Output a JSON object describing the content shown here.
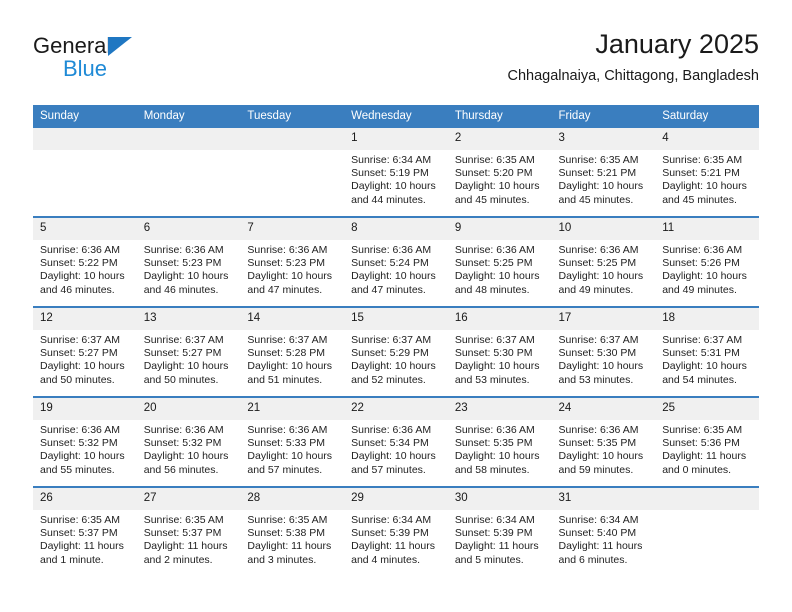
{
  "brand": {
    "line1": "General",
    "line2": "Blue",
    "triangle_color": "#1f77c2",
    "blue_color": "#1f8ad6"
  },
  "header": {
    "title": "January 2025",
    "subtitle": "Chhagalnaiya, Chittagong, Bangladesh",
    "accent_color": "#3a7ebf"
  },
  "calendar": {
    "weekday_headers": [
      "Sunday",
      "Monday",
      "Tuesday",
      "Wednesday",
      "Thursday",
      "Friday",
      "Saturday"
    ],
    "weeks": [
      [
        {
          "day": "",
          "empty": true
        },
        {
          "day": "",
          "empty": true
        },
        {
          "day": "",
          "empty": true
        },
        {
          "day": "1",
          "sunrise": "Sunrise: 6:34 AM",
          "sunset": "Sunset: 5:19 PM",
          "daylight": "Daylight: 10 hours and 44 minutes."
        },
        {
          "day": "2",
          "sunrise": "Sunrise: 6:35 AM",
          "sunset": "Sunset: 5:20 PM",
          "daylight": "Daylight: 10 hours and 45 minutes."
        },
        {
          "day": "3",
          "sunrise": "Sunrise: 6:35 AM",
          "sunset": "Sunset: 5:21 PM",
          "daylight": "Daylight: 10 hours and 45 minutes."
        },
        {
          "day": "4",
          "sunrise": "Sunrise: 6:35 AM",
          "sunset": "Sunset: 5:21 PM",
          "daylight": "Daylight: 10 hours and 45 minutes."
        }
      ],
      [
        {
          "day": "5",
          "sunrise": "Sunrise: 6:36 AM",
          "sunset": "Sunset: 5:22 PM",
          "daylight": "Daylight: 10 hours and 46 minutes."
        },
        {
          "day": "6",
          "sunrise": "Sunrise: 6:36 AM",
          "sunset": "Sunset: 5:23 PM",
          "daylight": "Daylight: 10 hours and 46 minutes."
        },
        {
          "day": "7",
          "sunrise": "Sunrise: 6:36 AM",
          "sunset": "Sunset: 5:23 PM",
          "daylight": "Daylight: 10 hours and 47 minutes."
        },
        {
          "day": "8",
          "sunrise": "Sunrise: 6:36 AM",
          "sunset": "Sunset: 5:24 PM",
          "daylight": "Daylight: 10 hours and 47 minutes."
        },
        {
          "day": "9",
          "sunrise": "Sunrise: 6:36 AM",
          "sunset": "Sunset: 5:25 PM",
          "daylight": "Daylight: 10 hours and 48 minutes."
        },
        {
          "day": "10",
          "sunrise": "Sunrise: 6:36 AM",
          "sunset": "Sunset: 5:25 PM",
          "daylight": "Daylight: 10 hours and 49 minutes."
        },
        {
          "day": "11",
          "sunrise": "Sunrise: 6:36 AM",
          "sunset": "Sunset: 5:26 PM",
          "daylight": "Daylight: 10 hours and 49 minutes."
        }
      ],
      [
        {
          "day": "12",
          "sunrise": "Sunrise: 6:37 AM",
          "sunset": "Sunset: 5:27 PM",
          "daylight": "Daylight: 10 hours and 50 minutes."
        },
        {
          "day": "13",
          "sunrise": "Sunrise: 6:37 AM",
          "sunset": "Sunset: 5:27 PM",
          "daylight": "Daylight: 10 hours and 50 minutes."
        },
        {
          "day": "14",
          "sunrise": "Sunrise: 6:37 AM",
          "sunset": "Sunset: 5:28 PM",
          "daylight": "Daylight: 10 hours and 51 minutes."
        },
        {
          "day": "15",
          "sunrise": "Sunrise: 6:37 AM",
          "sunset": "Sunset: 5:29 PM",
          "daylight": "Daylight: 10 hours and 52 minutes."
        },
        {
          "day": "16",
          "sunrise": "Sunrise: 6:37 AM",
          "sunset": "Sunset: 5:30 PM",
          "daylight": "Daylight: 10 hours and 53 minutes."
        },
        {
          "day": "17",
          "sunrise": "Sunrise: 6:37 AM",
          "sunset": "Sunset: 5:30 PM",
          "daylight": "Daylight: 10 hours and 53 minutes."
        },
        {
          "day": "18",
          "sunrise": "Sunrise: 6:37 AM",
          "sunset": "Sunset: 5:31 PM",
          "daylight": "Daylight: 10 hours and 54 minutes."
        }
      ],
      [
        {
          "day": "19",
          "sunrise": "Sunrise: 6:36 AM",
          "sunset": "Sunset: 5:32 PM",
          "daylight": "Daylight: 10 hours and 55 minutes."
        },
        {
          "day": "20",
          "sunrise": "Sunrise: 6:36 AM",
          "sunset": "Sunset: 5:32 PM",
          "daylight": "Daylight: 10 hours and 56 minutes."
        },
        {
          "day": "21",
          "sunrise": "Sunrise: 6:36 AM",
          "sunset": "Sunset: 5:33 PM",
          "daylight": "Daylight: 10 hours and 57 minutes."
        },
        {
          "day": "22",
          "sunrise": "Sunrise: 6:36 AM",
          "sunset": "Sunset: 5:34 PM",
          "daylight": "Daylight: 10 hours and 57 minutes."
        },
        {
          "day": "23",
          "sunrise": "Sunrise: 6:36 AM",
          "sunset": "Sunset: 5:35 PM",
          "daylight": "Daylight: 10 hours and 58 minutes."
        },
        {
          "day": "24",
          "sunrise": "Sunrise: 6:36 AM",
          "sunset": "Sunset: 5:35 PM",
          "daylight": "Daylight: 10 hours and 59 minutes."
        },
        {
          "day": "25",
          "sunrise": "Sunrise: 6:35 AM",
          "sunset": "Sunset: 5:36 PM",
          "daylight": "Daylight: 11 hours and 0 minutes."
        }
      ],
      [
        {
          "day": "26",
          "sunrise": "Sunrise: 6:35 AM",
          "sunset": "Sunset: 5:37 PM",
          "daylight": "Daylight: 11 hours and 1 minute."
        },
        {
          "day": "27",
          "sunrise": "Sunrise: 6:35 AM",
          "sunset": "Sunset: 5:37 PM",
          "daylight": "Daylight: 11 hours and 2 minutes."
        },
        {
          "day": "28",
          "sunrise": "Sunrise: 6:35 AM",
          "sunset": "Sunset: 5:38 PM",
          "daylight": "Daylight: 11 hours and 3 minutes."
        },
        {
          "day": "29",
          "sunrise": "Sunrise: 6:34 AM",
          "sunset": "Sunset: 5:39 PM",
          "daylight": "Daylight: 11 hours and 4 minutes."
        },
        {
          "day": "30",
          "sunrise": "Sunrise: 6:34 AM",
          "sunset": "Sunset: 5:39 PM",
          "daylight": "Daylight: 11 hours and 5 minutes."
        },
        {
          "day": "31",
          "sunrise": "Sunrise: 6:34 AM",
          "sunset": "Sunset: 5:40 PM",
          "daylight": "Daylight: 11 hours and 6 minutes."
        },
        {
          "day": "",
          "empty": true
        }
      ]
    ]
  }
}
